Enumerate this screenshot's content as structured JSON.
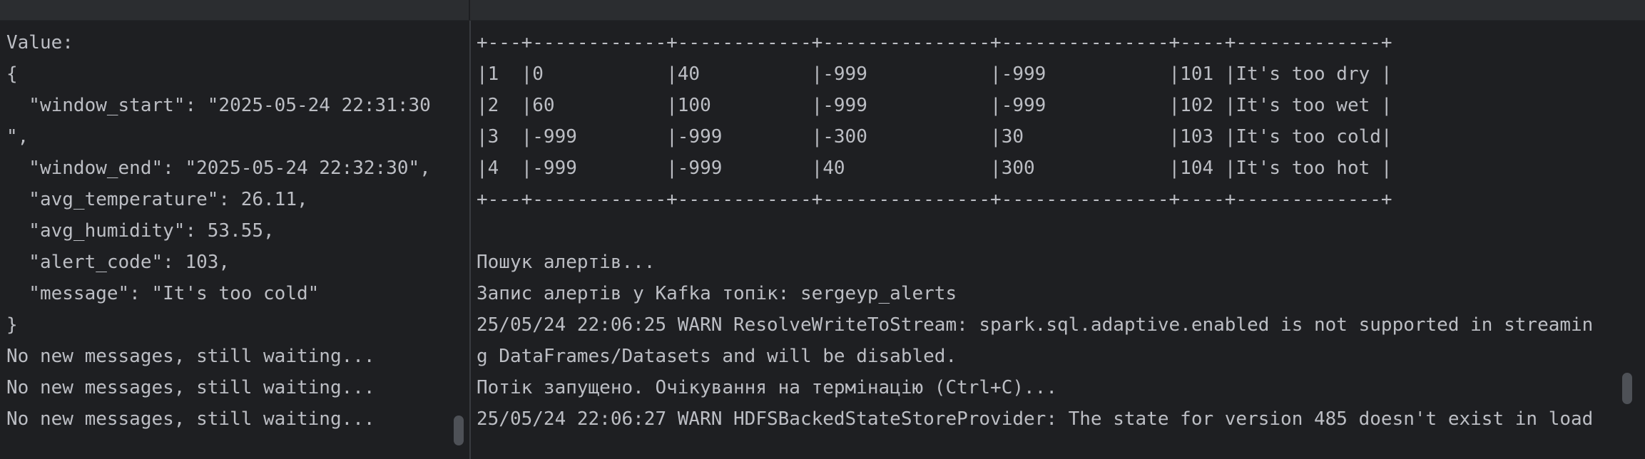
{
  "left_console": {
    "lines": [
      "Value:",
      "{",
      "  \"window_start\": \"2025-05-24 22:31:30",
      "\",",
      "  \"window_end\": \"2025-05-24 22:32:30\",",
      "  \"avg_temperature\": 26.11,",
      "  \"avg_humidity\": 53.55,",
      "  \"alert_code\": 103,",
      "  \"message\": \"It's too cold\"",
      "}",
      "No new messages, still waiting...",
      "No new messages, still waiting...",
      "No new messages, still waiting..."
    ]
  },
  "right_console": {
    "lines": [
      "+---+------------+------------+---------------+---------------+----+-------------+",
      "|1  |0           |40          |-999           |-999           |101 |It's too dry |",
      "|2  |60          |100         |-999           |-999           |102 |It's too wet |",
      "|3  |-999        |-999        |-300           |30             |103 |It's too cold|",
      "|4  |-999        |-999        |40             |300            |104 |It's too hot |",
      "+---+------------+------------+---------------+---------------+----+-------------+",
      "",
      "Пошук алертів...",
      "Запис алертів у Kafka топік: sergeyp_alerts",
      "25/05/24 22:06:25 WARN ResolveWriteToStream: spark.sql.adaptive.enabled is not supported in streamin",
      "g DataFrames/Datasets and will be disabled.",
      "Потік запущено. Очікування на термінацію (Ctrl+C)...",
      "25/05/24 22:06:27 WARN HDFSBackedStateStoreProvider: The state for version 485 doesn't exist in load"
    ]
  },
  "colors": {
    "background": "#1e1f22",
    "text": "#bcbec4",
    "topbar": "#2b2d30",
    "scrollbar": "#4e5157"
  }
}
